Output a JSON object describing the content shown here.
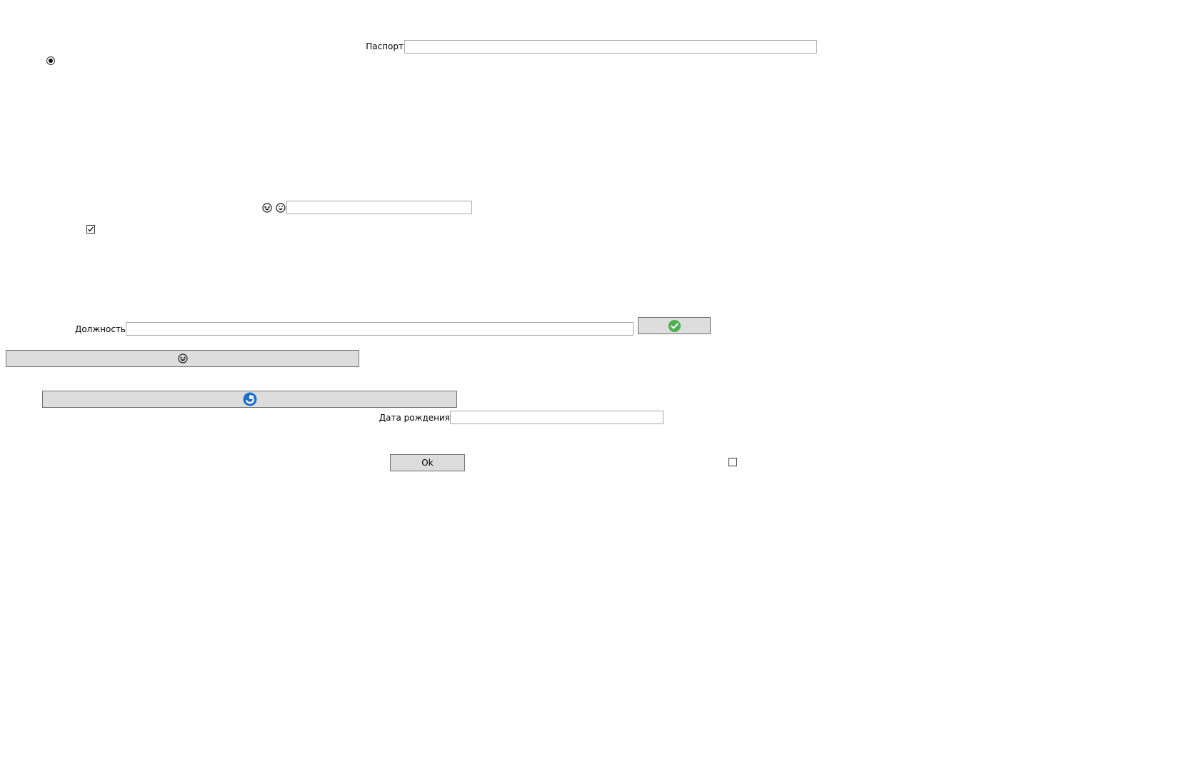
{
  "form": {
    "passport_label": "Паспорт",
    "passport_value": "",
    "position_label": "Должность",
    "position_value": "",
    "birthdate_label": "Дата рождения",
    "birthdate_value": "",
    "emoji_field_value": "",
    "ok_label": "Ok"
  },
  "controls": {
    "radio_selected": true,
    "checkbox_top_checked": true,
    "checkbox_bottom_checked": false
  },
  "icons": {
    "emoji_1": "grinning-squint-face-icon",
    "emoji_2": "smiling-face-icon",
    "confirm_button_icon": "green-check-circle-icon",
    "wide_button_icon": "grinning-squint-face-icon",
    "blue_button_icon": "blue-refresh-circle-icon"
  },
  "colors": {
    "button_bg": "#dddddd",
    "check_green": "#4caf50",
    "blue_icon": "#1e6fc8"
  }
}
